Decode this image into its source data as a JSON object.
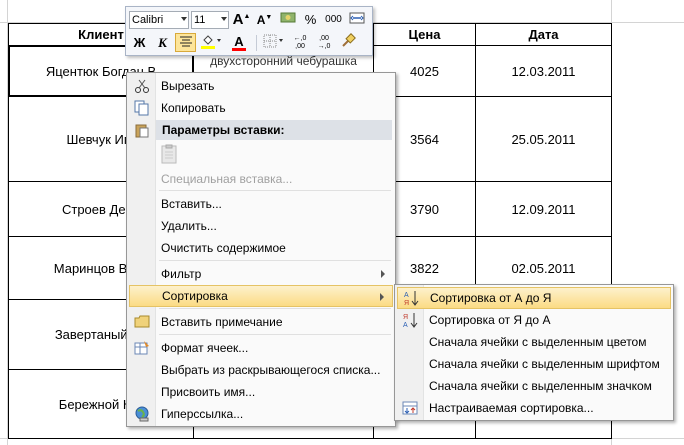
{
  "table": {
    "headers": {
      "client": "Клиент",
      "price": "Цена",
      "date": "Дата"
    },
    "rows": [
      {
        "client": "Яцентюк Богдан В",
        "product_partial": "двухсторонний чебурашка",
        "price": "4025",
        "date": "12.03.2011"
      },
      {
        "client": "Шевчук Иго",
        "price": "3564",
        "date": "25.05.2011"
      },
      {
        "client": "Строев Дени",
        "price": "3790",
        "date": "12.09.2011"
      },
      {
        "client": "Маринцов Вячи",
        "price": "3822",
        "date": "02.05.2011"
      },
      {
        "client": "Завертаный Ар",
        "price": "",
        "date": ""
      },
      {
        "client": "Бережной Юр",
        "price": "",
        "date": ""
      }
    ]
  },
  "minibar": {
    "font_name": "Calibri",
    "font_size": "11",
    "percent": "%",
    "thousands": "000",
    "bold": "Ж",
    "italic": "К",
    "font_color_letter": "A",
    "dec_inc": ",0 ,00",
    "dec_dec": ",00 ,0",
    "accent_fill": "#ffff00",
    "accent_font": "#ff0000"
  },
  "context_menu": {
    "cut": "Вырезать",
    "copy": "Копировать",
    "paste_options": "Параметры вставки:",
    "paste_special": "Специальная вставка...",
    "insert": "Вставить...",
    "delete": "Удалить...",
    "clear": "Очистить содержимое",
    "filter": "Фильтр",
    "sort": "Сортировка",
    "insert_comment": "Вставить примечание",
    "format_cells": "Формат ячеек...",
    "pick_list": "Выбрать из раскрывающегося списка...",
    "define_name": "Присвоить имя...",
    "hyperlink": "Гиперссылка..."
  },
  "sort_submenu": {
    "az": "Сортировка от А до Я",
    "za": "Сортировка от Я до А",
    "by_color": "Сначала ячейки с выделенным цветом",
    "by_font": "Сначала ячейки с выделенным шрифтом",
    "by_icon": "Сначала ячейки с выделенным значком",
    "custom": "Настраиваемая сортировка..."
  }
}
